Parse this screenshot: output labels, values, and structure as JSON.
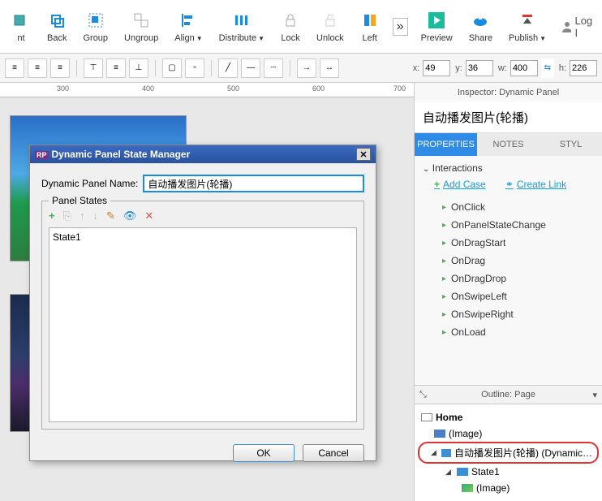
{
  "topbar": {
    "items": [
      {
        "label": "nt",
        "icon": "left-arrow"
      },
      {
        "label": "Back",
        "icon": "back"
      },
      {
        "label": "Group",
        "icon": "group"
      },
      {
        "label": "Ungroup",
        "icon": "ungroup"
      },
      {
        "label": "Align",
        "icon": "align",
        "caret": true
      },
      {
        "label": "Distribute",
        "icon": "distribute",
        "caret": true
      },
      {
        "label": "Lock",
        "icon": "lock"
      },
      {
        "label": "Unlock",
        "icon": "unlock"
      },
      {
        "label": "Left",
        "icon": "flag"
      }
    ],
    "more_label": "»",
    "preview": "Preview",
    "share": "Share",
    "publish": "Publish",
    "login": "Log I"
  },
  "formatbar": {
    "x_label": "x:",
    "x_value": "49",
    "y_label": "y:",
    "y_value": "36",
    "w_label": "w:",
    "w_value": "400",
    "h_label": "h:",
    "h_value": "226"
  },
  "ruler": {
    "t300": "300",
    "t400": "400",
    "t500": "500",
    "t600": "600",
    "t700": "700"
  },
  "dialog": {
    "title": "Dynamic Panel State Manager",
    "name_label": "Dynamic Panel Name:",
    "name_value": "自动播发图片(轮播)",
    "states_legend": "Panel States",
    "states": [
      "State1"
    ],
    "ok": "OK",
    "cancel": "Cancel"
  },
  "inspector": {
    "header": "Inspector: Dynamic Panel",
    "name": "自动播发图片(轮播)",
    "tabs": {
      "properties": "PROPERTIES",
      "notes": "NOTES",
      "style": "STYL"
    },
    "interactions_label": "Interactions",
    "add_case": "Add Case",
    "create_link": "Create Link",
    "events": [
      "OnClick",
      "OnPanelStateChange",
      "OnDragStart",
      "OnDrag",
      "OnDragDrop",
      "OnSwipeLeft",
      "OnSwipeRight",
      "OnLoad"
    ]
  },
  "outline": {
    "header": "Outline: Page",
    "home": "Home",
    "image1": "(Image)",
    "dp": "自动播发图片(轮播) (Dynamic Panel)",
    "state1": "State1",
    "image2": "(Image)"
  }
}
